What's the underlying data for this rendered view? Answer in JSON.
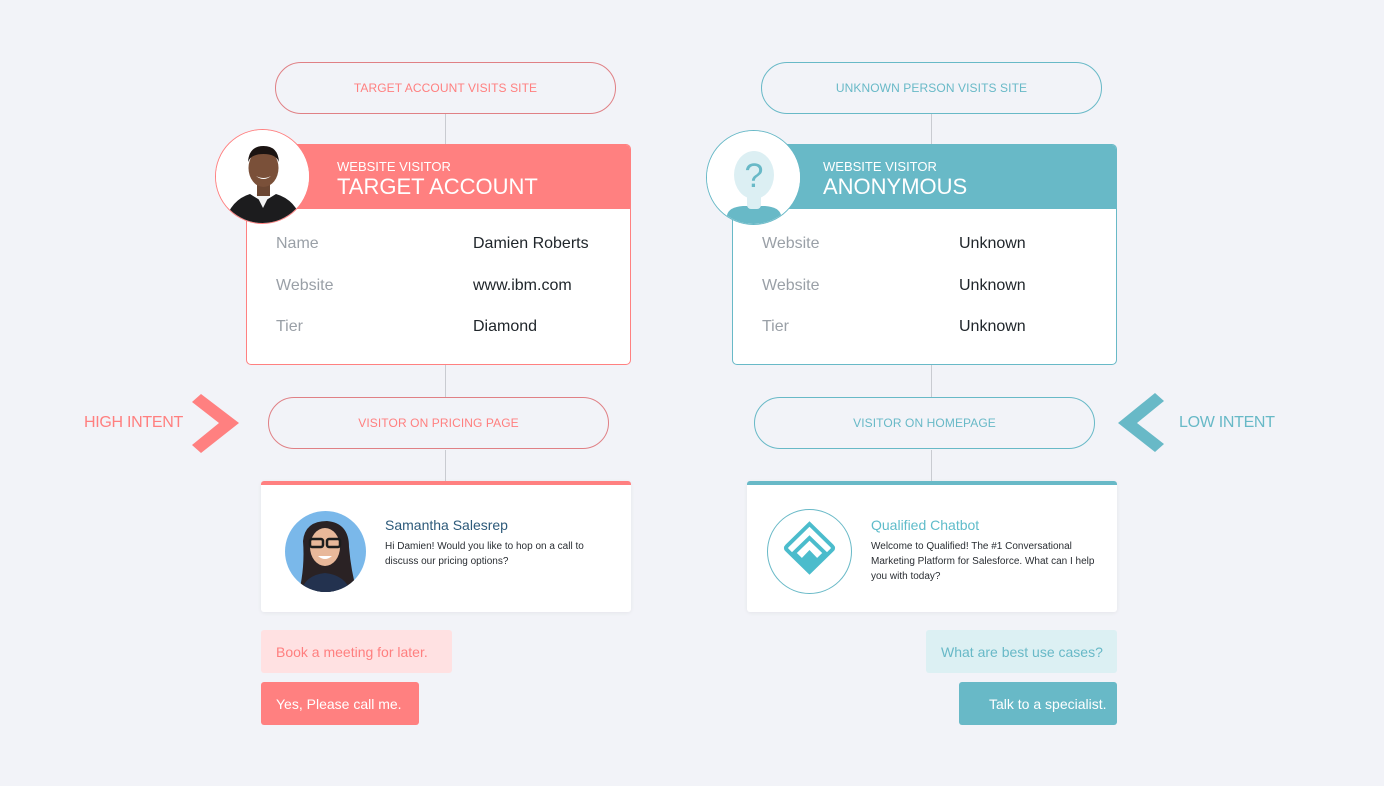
{
  "colors": {
    "high": "#ff8080",
    "low": "#68b9c7",
    "background": "#f2f3f8"
  },
  "left": {
    "start_pill": "TARGET ACCOUNT VISITS SITE",
    "card": {
      "subtitle": "WEBSITE VISITOR",
      "title": "TARGET ACCOUNT",
      "avatar": "photo-man-icon",
      "rows": [
        {
          "label": "Name",
          "value": "Damien Roberts"
        },
        {
          "label": "Website",
          "value": "www.ibm.com"
        },
        {
          "label": "Tier",
          "value": "Diamond"
        }
      ]
    },
    "intent_label": "HIGH INTENT",
    "intent_icon": "chevron-right-icon",
    "page_pill": "VISITOR ON PRICING PAGE",
    "chat": {
      "sender": "Samantha Salesrep",
      "message": "Hi Damien! Would you like to hop on a call to discuss our pricing options?",
      "avatar": "photo-woman-icon"
    },
    "buttons": [
      "Book a meeting for later.",
      "Yes, Please call me."
    ]
  },
  "right": {
    "start_pill": "UNKNOWN PERSON VISITS SITE",
    "card": {
      "subtitle": "WEBSITE VISITOR",
      "title": "ANONYMOUS",
      "avatar": "anonymous-user-icon",
      "rows": [
        {
          "label": "Website",
          "value": "Unknown"
        },
        {
          "label": "Website",
          "value": "Unknown"
        },
        {
          "label": "Tier",
          "value": "Unknown"
        }
      ]
    },
    "intent_label": "LOW INTENT",
    "intent_icon": "chevron-left-icon",
    "page_pill": "VISITOR ON HOMEPAGE",
    "chat": {
      "sender": "Qualified Chatbot",
      "message": "Welcome to Qualified! The #1 Conversational Marketing Platform for Salesforce. What can I help you with today?",
      "avatar": "qualified-logo-icon"
    },
    "buttons": [
      "What are best use cases?",
      "Talk to a specialist."
    ]
  }
}
